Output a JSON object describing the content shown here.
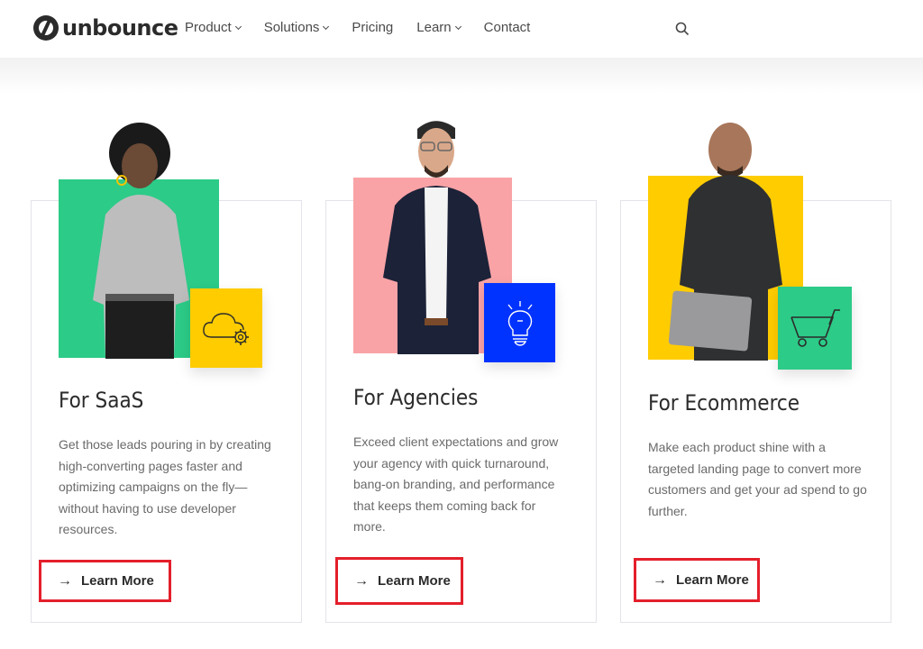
{
  "header": {
    "brand": "unbounce",
    "nav": [
      {
        "label": "Product",
        "dropdown": true
      },
      {
        "label": "Solutions",
        "dropdown": true
      },
      {
        "label": "Pricing",
        "dropdown": false
      },
      {
        "label": "Learn",
        "dropdown": true
      },
      {
        "label": "Contact",
        "dropdown": false
      }
    ],
    "search_icon": "search-icon"
  },
  "cards": [
    {
      "title": "For SaaS",
      "description": "Get those leads pouring in by creating high-converting pages faster and optimizing campaigns on the fly—without having to use developer resources.",
      "cta": "Learn More",
      "cta_icon": "arrow-right-icon",
      "photo_bg_color": "#2ccb87",
      "tile_color": "#ffcc00",
      "tile_icon": "cloud-gear-icon"
    },
    {
      "title": "For Agencies",
      "description": "Exceed client expectations and grow your agency with quick turnaround, bang-on branding, and performance that keeps them coming back for more.",
      "cta": "Learn More",
      "cta_icon": "arrow-right-icon",
      "photo_bg_color": "#f9a3a6",
      "tile_color": "#0033ff",
      "tile_icon": "lightbulb-icon"
    },
    {
      "title": "For Ecommerce",
      "description": "Make each product shine with a targeted landing page to convert more customers and get your ad spend to go further.",
      "cta": "Learn More",
      "cta_icon": "arrow-right-icon",
      "photo_bg_color": "#ffcc00",
      "tile_color": "#2ccb87",
      "tile_icon": "shopping-cart-icon"
    }
  ],
  "colors": {
    "highlight_border": "#e41f2b",
    "text_dark": "#2b2b2b",
    "text_muted": "#6a6a6a"
  }
}
